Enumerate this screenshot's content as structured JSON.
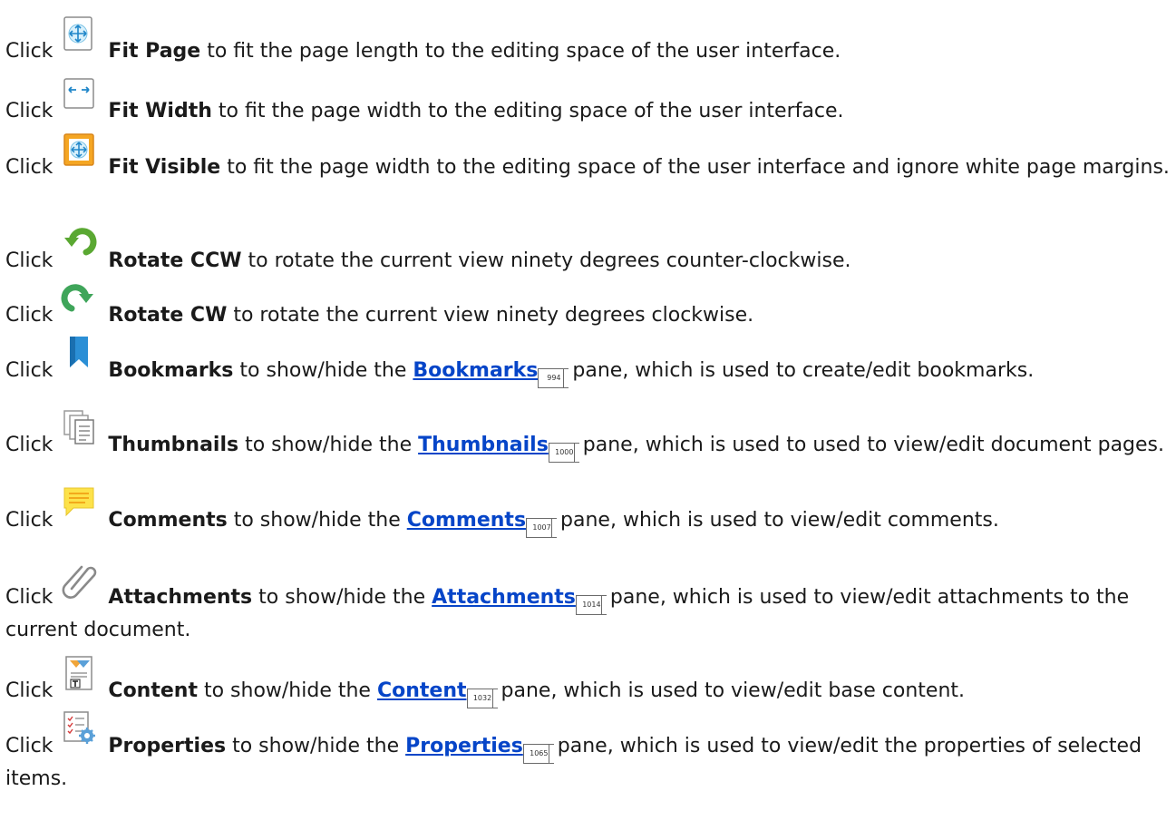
{
  "items": [
    {
      "pre": "Click",
      "name": "Fit Page",
      "post": " to fit the page length to the editing space of the user interface."
    },
    {
      "pre": "Click",
      "name": "Fit Width",
      "post": " to fit the page width to the editing space of the user interface."
    },
    {
      "pre": "Click",
      "name": "Fit Visible",
      "post": " to fit the page width to the editing space of the user interface and ignore white page margins."
    },
    {
      "pre": "Click",
      "name": "Rotate CCW",
      "post": "  to rotate the current view ninety degrees counter-clockwise."
    },
    {
      "pre": "Click",
      "name": "Rotate CW",
      "post": "  to rotate the current view ninety degrees clockwise."
    },
    {
      "pre": "Click",
      "name": "Bookmarks",
      "mid": " to show/hide the ",
      "link": "Bookmarks",
      "page": "994",
      "post": "pane, which is used to create/edit bookmarks."
    },
    {
      "pre": "Click",
      "name": "Thumbnails",
      "mid": " to show/hide the ",
      "link": "Thumbnails",
      "page": "1000",
      "post": "pane, which is used to used to view/edit document pages."
    },
    {
      "pre": "Click",
      "name": "Comments",
      "mid": " to show/hide the ",
      "link": "Comments",
      "page": "1007",
      "post": "pane, which is used to view/edit comments."
    },
    {
      "pre": "Click",
      "name": "Attachments",
      "mid": " to show/hide the ",
      "link": "Attachments",
      "page": "1014",
      "post": "pane, which is used to view/edit attachments to the current document."
    },
    {
      "pre": "Click",
      "name": "Content",
      "mid": " to show/hide the ",
      "link": "Content",
      "page": "1032",
      "post": "pane, which is used to view/edit base content."
    },
    {
      "pre": "Click",
      "name": "Properties",
      "mid": " to show/hide the ",
      "link": "Properties",
      "page": "1065",
      "post": "pane, which is used to view/edit the properties of selected items."
    }
  ],
  "icons": [
    "fit-page-icon",
    "fit-width-icon",
    "fit-visible-icon",
    "rotate-ccw-icon",
    "rotate-cw-icon",
    "bookmark-icon",
    "thumbnails-icon",
    "comments-icon",
    "attachment-icon",
    "content-icon",
    "properties-icon"
  ]
}
